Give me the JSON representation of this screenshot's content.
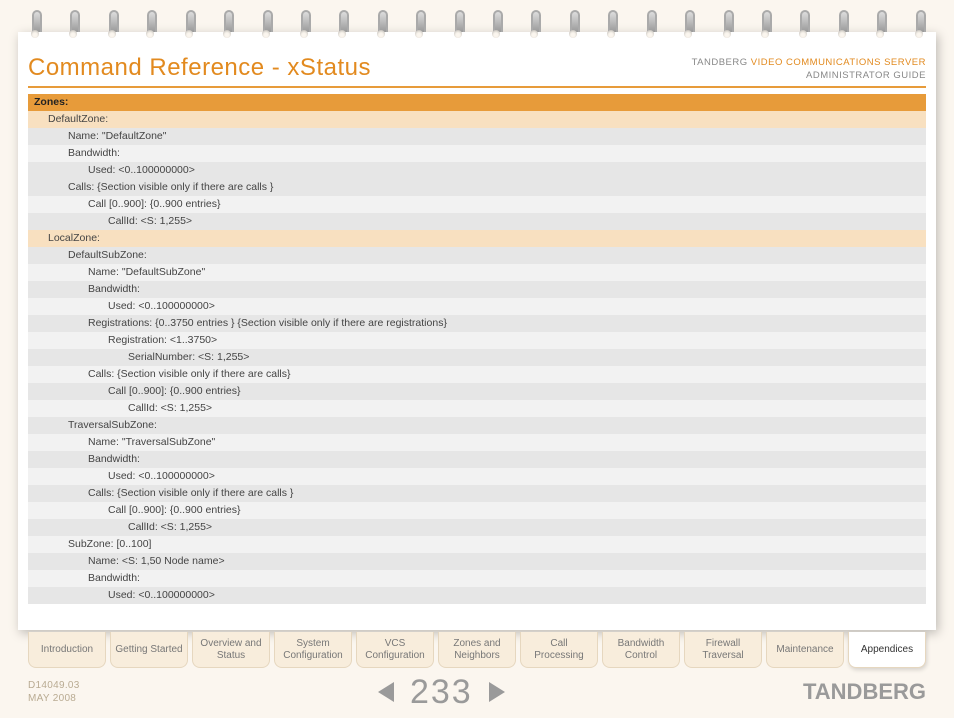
{
  "header": {
    "title": "Command Reference - xStatus",
    "brand_prefix": "TANDBERG",
    "brand_product": "VIDEO COMMUNICATIONS SERVER",
    "brand_subtitle": "ADMINISTRATOR GUIDE"
  },
  "rows": [
    {
      "cls": "hdr",
      "text": "Zones:"
    },
    {
      "cls": "lvl1",
      "text": "DefaultZone:"
    },
    {
      "cls": "lvl2a",
      "text": "Name: \"DefaultZone\""
    },
    {
      "cls": "lvl2b",
      "text": "Bandwidth:"
    },
    {
      "cls": "lvl3a",
      "text": "Used: <0..100000000>"
    },
    {
      "cls": "lvl2a",
      "text": "Calls: {Section visible only if there are calls }"
    },
    {
      "cls": "lvl3b",
      "text": "Call [0..900]: {0..900 entries}"
    },
    {
      "cls": "lvl4a",
      "text": "CallId: <S: 1,255>"
    },
    {
      "cls": "lvl1",
      "text": "LocalZone:"
    },
    {
      "cls": "lvl2a",
      "text": "DefaultSubZone:"
    },
    {
      "cls": "lvl3b",
      "text": "Name: \"DefaultSubZone\""
    },
    {
      "cls": "lvl3a",
      "text": "Bandwidth:"
    },
    {
      "cls": "lvl4b",
      "text": "Used: <0..100000000>"
    },
    {
      "cls": "lvl3a",
      "text": "Registrations: {0..3750 entries } {Section visible only if there are registrations}"
    },
    {
      "cls": "lvl4b",
      "text": "Registration: <1..3750>"
    },
    {
      "cls": "lvl5a",
      "text": "SerialNumber: <S: 1,255>"
    },
    {
      "cls": "lvl3b",
      "text": "Calls: {Section visible only if there are calls}"
    },
    {
      "cls": "lvl4a",
      "text": "Call [0..900]: {0..900 entries}"
    },
    {
      "cls": "lvl5b",
      "text": "CallId: <S: 1,255>"
    },
    {
      "cls": "lvl2a",
      "text": "TraversalSubZone:"
    },
    {
      "cls": "lvl3b",
      "text": "Name: \"TraversalSubZone\""
    },
    {
      "cls": "lvl3a",
      "text": "Bandwidth:"
    },
    {
      "cls": "lvl4b",
      "text": "Used: <0..100000000>"
    },
    {
      "cls": "lvl3a",
      "text": "Calls: {Section visible only if there are calls }"
    },
    {
      "cls": "lvl4b",
      "text": "Call [0..900]: {0..900 entries}"
    },
    {
      "cls": "lvl5a",
      "text": "CallId: <S: 1,255>"
    },
    {
      "cls": "lvl2b",
      "text": "SubZone: [0..100]"
    },
    {
      "cls": "lvl3a",
      "text": "Name: <S: 1,50 Node name>"
    },
    {
      "cls": "lvl3b",
      "text": "Bandwidth:"
    },
    {
      "cls": "lvl4a",
      "text": "Used: <0..100000000>"
    }
  ],
  "tabs": [
    {
      "label": "Introduction",
      "active": false
    },
    {
      "label": "Getting Started",
      "active": false
    },
    {
      "label": "Overview and Status",
      "active": false
    },
    {
      "label": "System Configuration",
      "active": false
    },
    {
      "label": "VCS Configuration",
      "active": false
    },
    {
      "label": "Zones and Neighbors",
      "active": false
    },
    {
      "label": "Call Processing",
      "active": false
    },
    {
      "label": "Bandwidth Control",
      "active": false
    },
    {
      "label": "Firewall Traversal",
      "active": false
    },
    {
      "label": "Maintenance",
      "active": false
    },
    {
      "label": "Appendices",
      "active": true
    }
  ],
  "footer": {
    "doc_id": "D14049.03",
    "doc_date": "MAY 2008",
    "page_number": "233",
    "logo": "TANDBERG"
  }
}
